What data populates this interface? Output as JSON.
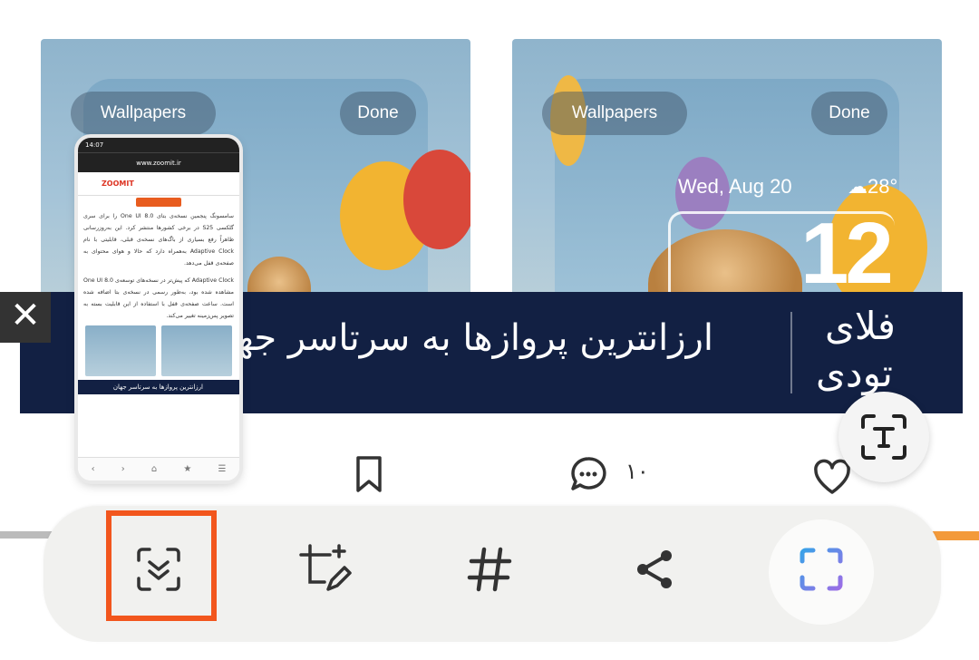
{
  "wallpapers": {
    "left": {
      "wallpapers_label": "Wallpapers",
      "done_label": "Done"
    },
    "right": {
      "wallpapers_label": "Wallpapers",
      "done_label": "Done",
      "date": "Wed, Aug 20",
      "temperature": "28°",
      "time": "12"
    }
  },
  "ad": {
    "text": "ارزانترین پروازها به سرتاسر جهان",
    "logo_line1": "فلای",
    "logo_line2": "تودی",
    "close_symbol": "✕"
  },
  "article_actions": {
    "comment_count": "۱۰"
  },
  "thumbnail": {
    "status_time": "14:07",
    "url": "www.zoomit.ir",
    "brand": "ZOOMIT",
    "paragraph1": "سامسونگ پنجمین نسخه‌ی بتای One UI 8.0 را برای سری گلکسی S25 در برخی کشورها منتشر کرد. این به‌روزرسانی ظاهراً رفع بسیاری از باگ‌های نسخه‌ی قبلی، قابلیتی با نام Adaptive Clock به‌همراه دارد که حالا و هوای محتوای به صفحه‌ی قفل می‌دهد.",
    "paragraph2": "Adaptive Clock که پیش‌تر در نسخه‌های توسعه‌ی One UI 8.0 مشاهده شده بود، به‌طور رسمی در نسخه‌ی بتا اضافه شده است. ساعت صفحه‌ی قفل با استفاده از این قابلیت بسته به تصویر پس‌زمینه تغییر می‌کند.",
    "ad_text": "ارزانترین پروازها به سرتاسر جهان"
  },
  "colors": {
    "highlight": "#f2561d",
    "ad_background": "#122043",
    "toolbar_background": "#f1f1ef"
  },
  "icons": {
    "toolbar": [
      "scroll-capture-icon",
      "crop-edit-icon",
      "hashtag-icon",
      "share-icon",
      "screen-capture-icon"
    ]
  }
}
